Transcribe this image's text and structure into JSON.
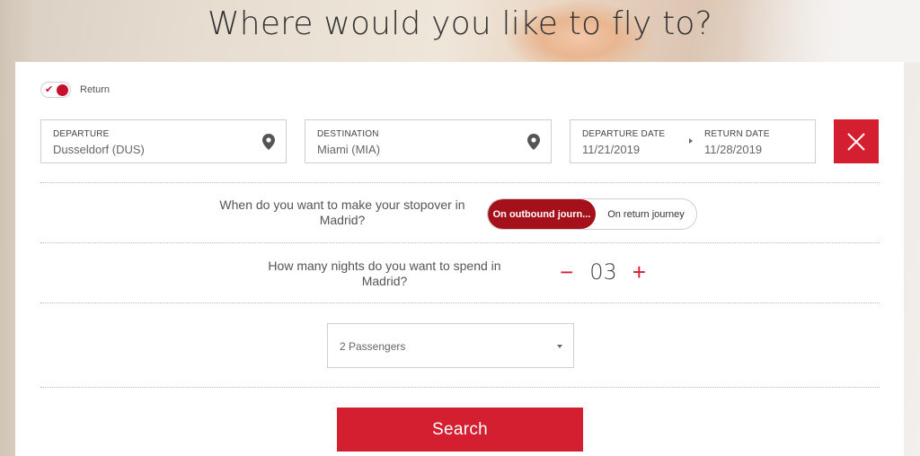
{
  "hero": {
    "title": "Where would you like to fly to?"
  },
  "trip": {
    "return_label": "Return",
    "return_enabled": true
  },
  "fields": {
    "departure": {
      "label": "DEPARTURE",
      "value": "Dusseldorf (DUS)",
      "icon": "location-pin-icon"
    },
    "destination": {
      "label": "DESTINATION",
      "value": "Miami (MIA)",
      "icon": "location-pin-icon"
    },
    "dates": {
      "departure_label": "DEPARTURE DATE",
      "departure_value": "11/21/2019",
      "return_label": "RETURN DATE",
      "return_value": "11/28/2019"
    }
  },
  "close": {
    "icon": "close-icon"
  },
  "stopover": {
    "question": "When do you want to make your stopover in Madrid?",
    "options": [
      "On outbound journ...",
      "On return journey"
    ],
    "selected": "On outbound journ..."
  },
  "nights": {
    "question": "How many nights do you want to spend in Madrid?",
    "value": "03",
    "minus": "−",
    "plus": "+"
  },
  "passengers": {
    "value": "2 Passengers"
  },
  "search": {
    "label": "Search"
  },
  "colors": {
    "accent": "#d41f30",
    "accent_dark": "#a5111b"
  }
}
